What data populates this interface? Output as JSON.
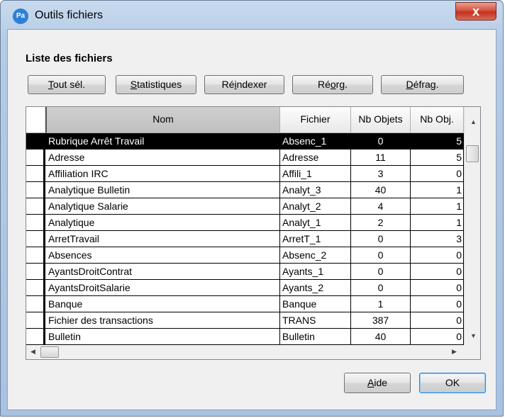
{
  "window": {
    "title": "Outils fichiers",
    "app_icon": "Pa",
    "close_symbol": "x"
  },
  "section_title": "Liste des fichiers",
  "toolbar": [
    {
      "pre": "",
      "u": "T",
      "post": "out sél."
    },
    {
      "pre": "",
      "u": "S",
      "post": "tatistiques"
    },
    {
      "pre": "Ré",
      "u": "i",
      "post": "ndexer"
    },
    {
      "pre": "Ré",
      "u": "o",
      "post": "rg."
    },
    {
      "pre": "",
      "u": "D",
      "post": "éfrag."
    }
  ],
  "table": {
    "columns": [
      "Nom",
      "Fichier",
      "Nb Objets",
      "Nb Obj."
    ],
    "rows": [
      [
        "Rubrique Arrêt Travail",
        "Absenc_1",
        "0",
        "5"
      ],
      [
        "Adresse",
        "Adresse",
        "11",
        "5"
      ],
      [
        "Affiliation IRC",
        "Affili_1",
        "3",
        "0"
      ],
      [
        "Analytique Bulletin",
        "Analyt_3",
        "40",
        "1"
      ],
      [
        "Analytique Salarie",
        "Analyt_2",
        "4",
        "1"
      ],
      [
        "Analytique",
        "Analyt_1",
        "2",
        "1"
      ],
      [
        "ArretTravail",
        "ArretT_1",
        "0",
        "3"
      ],
      [
        "Absences",
        "Absenc_2",
        "0",
        "0"
      ],
      [
        "AyantsDroitContrat",
        "Ayants_1",
        "0",
        "0"
      ],
      [
        "AyantsDroitSalarie",
        "Ayants_2",
        "0",
        "0"
      ],
      [
        "Banque",
        "Banque",
        "1",
        "0"
      ],
      [
        "Fichier des transactions",
        "TRANS",
        "387",
        "0"
      ],
      [
        "Bulletin",
        "Bulletin",
        "40",
        "0"
      ]
    ],
    "selected_index": 0
  },
  "footer": {
    "help": {
      "pre": "",
      "u": "A",
      "post": "ide"
    },
    "ok_label": "OK"
  },
  "colors": {
    "selection": "#000000",
    "title_bar": "#b9cfe9",
    "close_button": "#c83c28",
    "client": "#f0f0f0"
  }
}
